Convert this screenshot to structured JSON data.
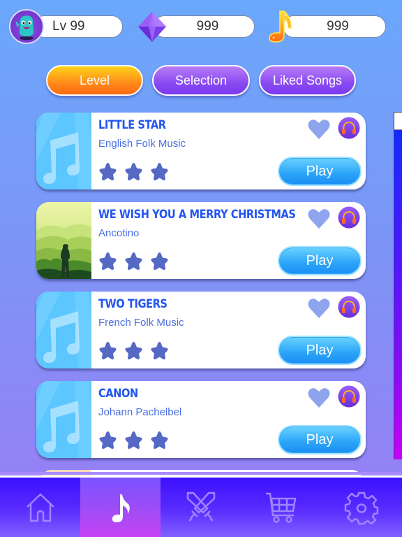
{
  "header": {
    "level_label": "Lv 99",
    "gems": "999",
    "notes": "999",
    "avatar_icon": "monster-avatar-icon",
    "gem_icon": "diamond-icon",
    "note_icon": "music-note-coin-icon"
  },
  "tabs": [
    {
      "label": "Level",
      "active": true
    },
    {
      "label": "Selection",
      "active": false
    },
    {
      "label": "Liked Songs",
      "active": false
    }
  ],
  "songs": [
    {
      "title": "LITTLE STAR",
      "artist": "English Folk Music",
      "stars": 3,
      "max_stars": 3,
      "liked": false,
      "thumbnail": "music-note",
      "play_label": "Play"
    },
    {
      "title": "WE WISH YOU A MERRY CHRISTMAS",
      "artist": "Ancotino",
      "stars": 3,
      "max_stars": 3,
      "liked": false,
      "thumbnail": "landscape",
      "play_label": "Play"
    },
    {
      "title": "TWO TIGERS",
      "artist": "French Folk Music",
      "stars": 3,
      "max_stars": 3,
      "liked": false,
      "thumbnail": "music-note",
      "play_label": "Play"
    },
    {
      "title": "CANON",
      "artist": "Johann Pachelbel",
      "stars": 3,
      "max_stars": 3,
      "liked": false,
      "thumbnail": "music-note",
      "play_label": "Play"
    }
  ],
  "nav": [
    {
      "name": "home",
      "icon": "home-icon",
      "active": false
    },
    {
      "name": "songs",
      "icon": "music-note-icon",
      "active": true
    },
    {
      "name": "battle",
      "icon": "crossed-swords-icon",
      "active": false
    },
    {
      "name": "shop",
      "icon": "shopping-cart-icon",
      "active": false
    },
    {
      "name": "settings",
      "icon": "gear-icon",
      "active": false
    }
  ],
  "colors": {
    "accent_orange": "#ff8a1a",
    "accent_purple": "#8a4af0",
    "title_blue": "#2455ee",
    "play_blue": "#2aa4f8",
    "star": "#5468c4",
    "heart": "#8ea4ee"
  }
}
